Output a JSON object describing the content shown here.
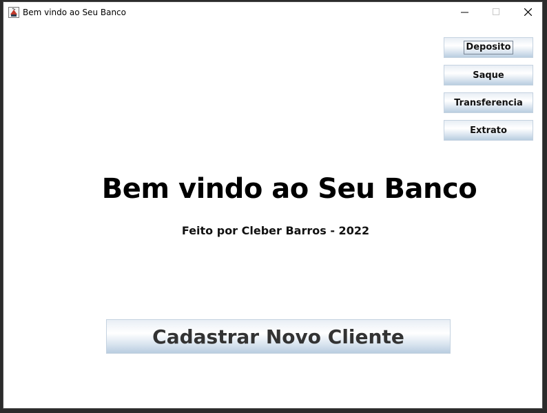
{
  "window": {
    "title": "Bem vindo ao Seu Banco",
    "app_icon": "java-cup-icon"
  },
  "title_buttons": {
    "minimize_icon": "minimize-icon",
    "maximize_icon": "maximize-icon",
    "close_icon": "close-icon"
  },
  "menu": {
    "deposito_label": "Deposito",
    "saque_label": "Saque",
    "transferencia_label": "Transferencia",
    "extrato_label": "Extrato"
  },
  "main": {
    "headline": "Bem vindo ao Seu Banco",
    "credit": "Feito por Cleber Barros - 2022",
    "register_button_label": "Cadastrar Novo Cliente"
  },
  "colors": {
    "button_gradient_top": "#e8eef5",
    "button_gradient_bottom": "#b9cde0",
    "background": "#ffffff"
  }
}
